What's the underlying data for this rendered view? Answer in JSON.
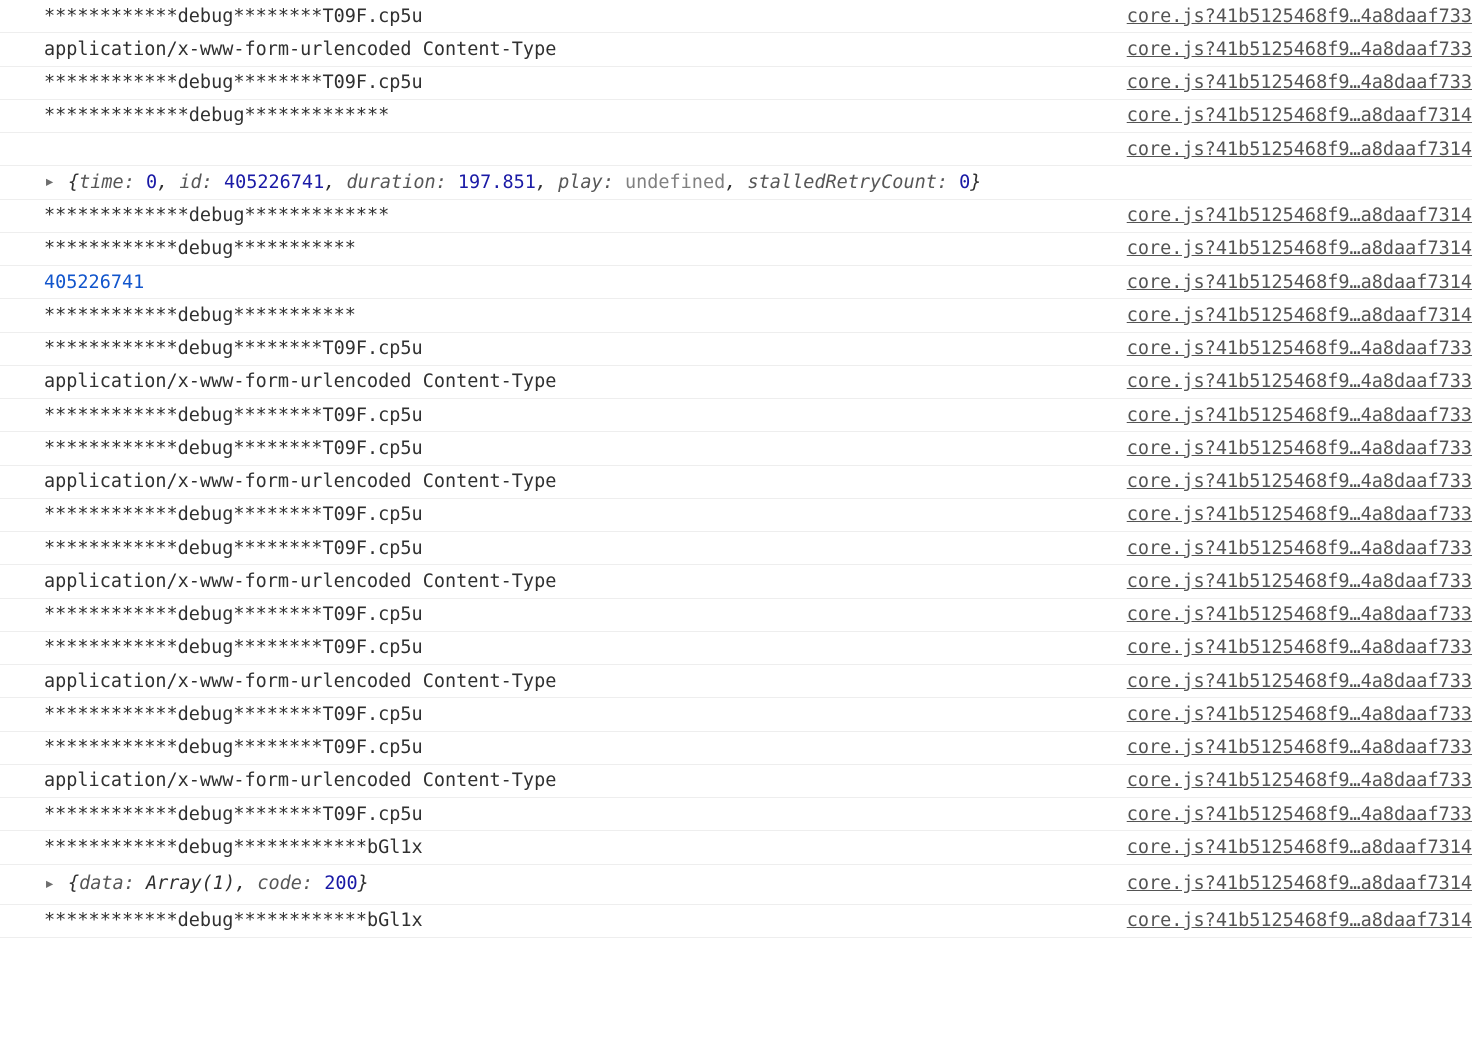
{
  "src_a": "core.js?41b5125468f9…4a8daaf733",
  "src_b": "core.js?41b5125468f9…a8daaf7314",
  "txt": {
    "debugT09F": "************debug********T09F.cp5u",
    "contentType": "application/x-www-form-urlencoded Content-Type",
    "debug13": "*************debug*************",
    "debug11_12": "************debug***********",
    "debug12_12": "************debug************bGl1x",
    "id405": "405226741"
  },
  "obj1": {
    "time_k": "time:",
    "time_v": "0",
    "id_k": "id:",
    "id_v": "405226741",
    "duration_k": "duration:",
    "duration_v": "197.851",
    "play_k": "play:",
    "play_v": "undefined",
    "stalled_k": "stalledRetryCount:",
    "stalled_v": "0"
  },
  "obj2": {
    "data_k": "data:",
    "data_v": "Array(1)",
    "code_k": "code:",
    "code_v": "200"
  },
  "rows": [
    {
      "kind": "plain",
      "text": "debugT09F",
      "src": "a"
    },
    {
      "kind": "plain",
      "text": "contentType",
      "src": "a"
    },
    {
      "kind": "plain",
      "text": "debugT09F",
      "src": "a"
    },
    {
      "kind": "plain",
      "text": "debug13",
      "src": "b"
    },
    {
      "kind": "srconly",
      "src": "b"
    },
    {
      "kind": "obj1"
    },
    {
      "kind": "plain",
      "text": "debug13",
      "src": "b"
    },
    {
      "kind": "plain",
      "text": "debug11_12",
      "src": "b"
    },
    {
      "kind": "link",
      "text": "id405",
      "src": "b"
    },
    {
      "kind": "plain",
      "text": "debug11_12",
      "src": "b"
    },
    {
      "kind": "plain",
      "text": "debugT09F",
      "src": "a"
    },
    {
      "kind": "plain",
      "text": "contentType",
      "src": "a"
    },
    {
      "kind": "plain",
      "text": "debugT09F",
      "src": "a"
    },
    {
      "kind": "plain",
      "text": "debugT09F",
      "src": "a"
    },
    {
      "kind": "plain",
      "text": "contentType",
      "src": "a"
    },
    {
      "kind": "plain",
      "text": "debugT09F",
      "src": "a"
    },
    {
      "kind": "plain",
      "text": "debugT09F",
      "src": "a"
    },
    {
      "kind": "plain",
      "text": "contentType",
      "src": "a"
    },
    {
      "kind": "plain",
      "text": "debugT09F",
      "src": "a"
    },
    {
      "kind": "plain",
      "text": "debugT09F",
      "src": "a"
    },
    {
      "kind": "plain",
      "text": "contentType",
      "src": "a"
    },
    {
      "kind": "plain",
      "text": "debugT09F",
      "src": "a"
    },
    {
      "kind": "plain",
      "text": "debugT09F",
      "src": "a"
    },
    {
      "kind": "plain",
      "text": "contentType",
      "src": "a"
    },
    {
      "kind": "plain",
      "text": "debugT09F",
      "src": "a"
    },
    {
      "kind": "plain",
      "text": "debug12_12",
      "src": "b"
    },
    {
      "kind": "obj2",
      "src": "b"
    },
    {
      "kind": "plain",
      "text": "debug12_12",
      "src": "b"
    }
  ]
}
